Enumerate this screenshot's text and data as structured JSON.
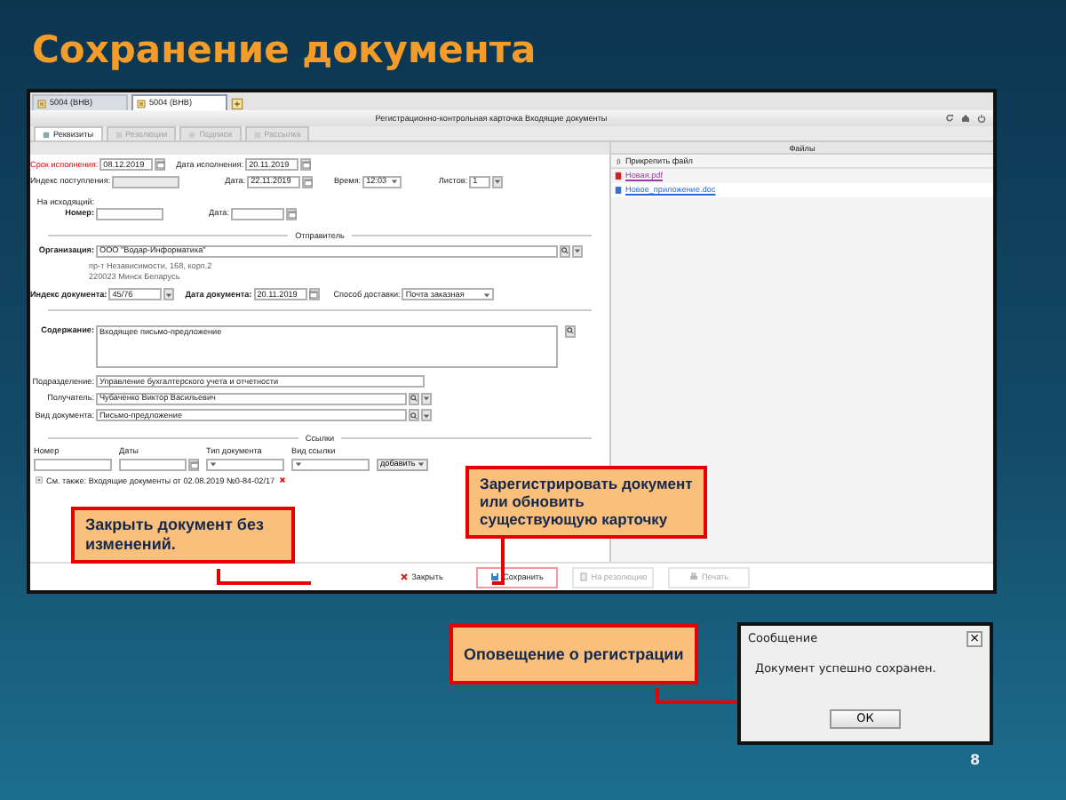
{
  "slide": {
    "title": "Сохранение документа",
    "page_number": "8"
  },
  "window": {
    "doc_tabs": [
      {
        "label": "5004 (ВНВ)",
        "selected": false
      },
      {
        "label": "5004 (ВНВ)",
        "selected": true
      }
    ],
    "title": "Регистрационно-контрольная карточка Входящие документы",
    "tabs": [
      {
        "label": "Реквизиты",
        "selected": true,
        "disabled": false
      },
      {
        "label": "Резолюции",
        "selected": false,
        "disabled": true
      },
      {
        "label": "Подписи",
        "selected": false,
        "disabled": true
      },
      {
        "label": "Рассылка",
        "selected": false,
        "disabled": true
      }
    ],
    "form": [
      {
        "kind": "fields",
        "fields": [
          {
            "label": "Срок исполнения:",
            "kind": "date",
            "value": "08.12.2019",
            "required": true,
            "bold": false
          },
          {
            "label": "Дата исполнения:",
            "kind": "date",
            "value": "20.11.2019",
            "required": false,
            "bold": false
          }
        ]
      },
      {
        "kind": "fields",
        "fields": [
          {
            "label": "Индекс поступления:",
            "kind": "readonly",
            "required": false,
            "bold": false
          },
          {
            "label": "Дата:",
            "kind": "date",
            "value": "22.11.2019",
            "required": false,
            "bold": false
          },
          {
            "label": "Время:",
            "kind": "select",
            "value": "12:03",
            "required": false,
            "bold": false
          },
          {
            "label": "Листов:",
            "kind": "spin",
            "value": "1",
            "required": false,
            "bold": false
          }
        ]
      },
      {
        "kind": "note",
        "text": "На исходящий:"
      },
      {
        "kind": "fields",
        "fields": [
          {
            "label": "Номер:",
            "kind": "text",
            "required": false,
            "bold": true
          },
          {
            "label": "Дата:",
            "kind": "date",
            "required": false,
            "bold": false
          }
        ]
      },
      {
        "kind": "section",
        "text": "Отправитель"
      },
      {
        "kind": "fields",
        "fields": [
          {
            "label": "Организация:",
            "kind": "lookup",
            "value": "ООО \"Водар-Информатика\"",
            "required": false,
            "bold": true
          }
        ]
      },
      {
        "kind": "address",
        "lines": [
          "пр-т Независимости, 168, корп.2",
          "220023 Минск Беларусь"
        ]
      },
      {
        "kind": "fields",
        "fields": [
          {
            "label": "Индекс документа:",
            "kind": "spin",
            "value": "45/76",
            "required": false,
            "bold": true
          },
          {
            "label": "Дата документа:",
            "kind": "date",
            "value": "20.11.2019",
            "required": false,
            "bold": true
          },
          {
            "label": "Способ доставки:",
            "kind": "select",
            "value": "Почта заказная",
            "required": false,
            "bold": false
          }
        ]
      },
      {
        "kind": "rule"
      },
      {
        "kind": "fields",
        "fields": [
          {
            "label": "Содержание:",
            "kind": "area",
            "value": "Входящее письмо-предложение",
            "required": false,
            "bold": true
          }
        ]
      },
      {
        "kind": "fields",
        "fields": [
          {
            "label": "Подразделение:",
            "kind": "text",
            "value": "Управление бухгалтерского учета и отчетности",
            "required": false,
            "bold": false
          }
        ]
      },
      {
        "kind": "fields",
        "fields": [
          {
            "label": "Получатель:",
            "kind": "lookup",
            "value": "Чубаченко Виктор Васильевич",
            "required": false,
            "bold": false
          }
        ]
      },
      {
        "kind": "fields",
        "fields": [
          {
            "label": "Вид документа:",
            "kind": "lookup",
            "value": "Письмо-предложение",
            "required": false,
            "bold": false
          }
        ]
      },
      {
        "kind": "section",
        "text": "Ссылки"
      },
      {
        "kind": "links",
        "columns": [
          {
            "label": "Номер",
            "kind": "text"
          },
          {
            "label": "Даты",
            "kind": "date"
          },
          {
            "label": "Тип документа",
            "kind": "select"
          },
          {
            "label": "Вид ссылки",
            "kind": "select"
          }
        ],
        "button": "добавить"
      },
      {
        "kind": "reference",
        "text": "См. также: Входящие документы от 02.08.2019 №0-84-02/17"
      }
    ],
    "files": {
      "title": "Файлы",
      "attach": "Прикрепить файл",
      "items": [
        {
          "name": "Новая.pdf",
          "visited": true
        },
        {
          "name": "Новое_приложение.doc",
          "visited": false
        }
      ]
    },
    "buttons": [
      {
        "label": "Закрыть",
        "disabled": false,
        "highlighted": false
      },
      {
        "label": "Сохранить",
        "disabled": false,
        "highlighted": true
      },
      {
        "label": "На резолюцию",
        "disabled": true,
        "highlighted": false
      },
      {
        "label": "Печать",
        "disabled": true,
        "highlighted": false
      }
    ]
  },
  "callouts": [
    {
      "text": "Закрыть документ без изменений."
    },
    {
      "text": "Зарегистрировать документ или обновить существующую карточку"
    },
    {
      "text": "Оповещение о регистрации"
    }
  ],
  "dialog": {
    "title": "Сообщение",
    "close": "×",
    "message": "Документ успешно сохранен.",
    "button": "ОК"
  }
}
